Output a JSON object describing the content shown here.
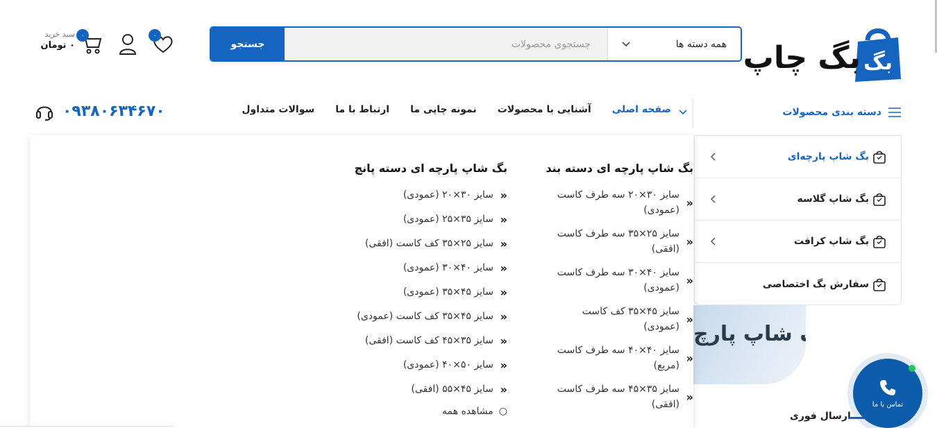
{
  "brand": {
    "logo_text": "بگ چاپ"
  },
  "search": {
    "category_label": "همه دسته ها",
    "placeholder": "جستجوی محصولات",
    "button_label": "جستجو"
  },
  "header_actions": {
    "wishlist_count": "۰",
    "cart_count": "۰",
    "cart_caption": "سبد خرید",
    "cart_total": "۰ تومان"
  },
  "nav": {
    "categories_label": "دسته بندی محصولات",
    "links": [
      "صفحه اصلی",
      "آشنایی با محصولات",
      "نمونه چاپی ما",
      "ارتباط با ما",
      "سوالات متداول"
    ],
    "phone": "۰۹۳۸۰۶۳۴۶۷۰"
  },
  "category_menu": [
    {
      "label": "بگ شاپ پارچه‌ای",
      "active": true,
      "has_children": true
    },
    {
      "label": "بگ شاپ گلاسه",
      "active": false,
      "has_children": true
    },
    {
      "label": "بگ شاپ کرافت",
      "active": false,
      "has_children": true
    },
    {
      "label": "سفارش بگ اختصاصی",
      "active": false,
      "has_children": false
    }
  ],
  "mega_menu": {
    "column1": {
      "title": "بگ شاپ پارچه ای دسته بند",
      "items": [
        "سایز ۳۰×۲۰ سه طرف کاست (عمودی)",
        "سایز ۲۵×۳۵ سه طرف کاست (افقی)",
        "سایز ۴۰×۳۰ سه طرف کاست (عمودی)",
        "سایز ۴۵×۳۵ کف کاست (عمودی)",
        "سایز ۴۰×۴۰ سه طرف کاست (مربع)",
        "سایز ۳۵×۴۵ سه طرف کاست (افقی)"
      ]
    },
    "column2": {
      "title": "بگ شاپ پارچه ای دسته پانچ",
      "items": [
        "سایز ۳۰×۲۰ (عمودی)",
        "سایز ۳۵×۲۵ (عمودی)",
        "سایز ۲۵×۳۵ کف کاست (افقی)",
        "سایز ۴۰×۳۰ (عمودی)",
        "سایز ۴۵×۳۵ (عمودی)",
        "سایز ۴۵×۳۵ کف کاست (عمودی)",
        "سایز ۳۵×۴۵ کف کاست (افقی)",
        "سایز ۵۰×۴۰ (عمودی)",
        "سایز ۴۵×۵۵ (افقی)"
      ],
      "see_all": "مشاهده همه"
    }
  },
  "banner": {
    "text": "بگ شاپ پارچ"
  },
  "feature": {
    "label": "ارسال فوری"
  },
  "contact_fab": {
    "label": "تماس با ما"
  },
  "colors": {
    "primary": "#1565c0",
    "fab": "#0d5cab",
    "online": "#22c55e"
  },
  "icons": [
    "bag-logo-icon",
    "chevron-down-icon",
    "heart-icon",
    "user-icon",
    "cart-icon",
    "hamburger-icon",
    "headset-icon",
    "shopping-bag-icon",
    "chevron-left-icon",
    "double-chevron-icon",
    "phone-icon"
  ]
}
